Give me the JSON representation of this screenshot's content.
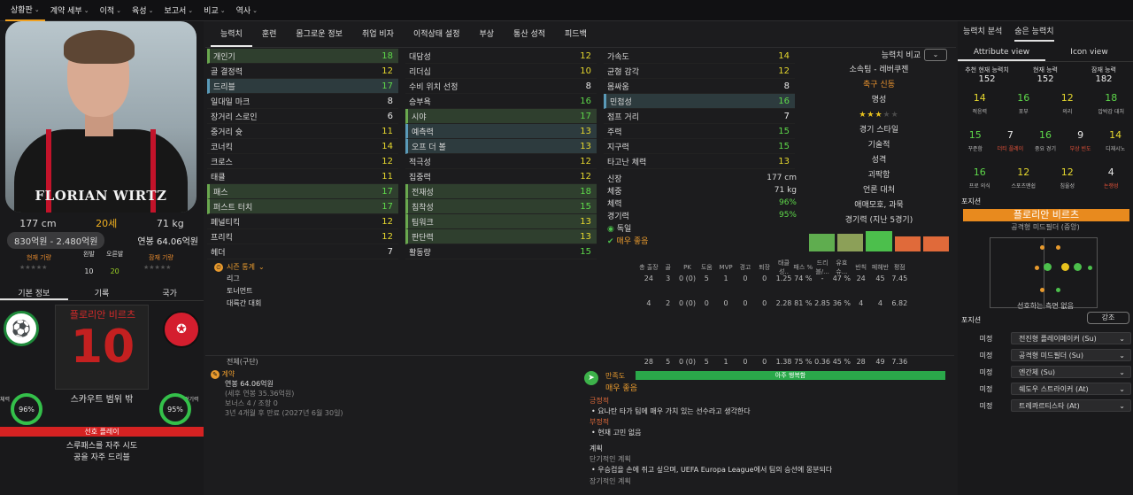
{
  "topbar": {
    "items": [
      {
        "label": "상황판",
        "active": true
      },
      {
        "label": "계약 세부"
      },
      {
        "label": "이적"
      },
      {
        "label": "육성"
      },
      {
        "label": "보고서"
      },
      {
        "label": "비교"
      },
      {
        "label": "역사"
      }
    ]
  },
  "player": {
    "photo_caption": "FLORIAN WIRTZ",
    "height": "177 cm",
    "age": "20세",
    "weight": "71 kg",
    "value_range": "830억원 - 2.480억원",
    "wage": "연봉 64.06억원",
    "current_ability_label": "현재 기량",
    "potential_ability_label": "잠재 기량",
    "left_foot_label": "왼발",
    "right_foot_label": "오른발",
    "left_foot_value": "10",
    "right_foot_value": "20",
    "name": "플로리안 비르츠",
    "number": "10",
    "scout_range": "스카우트 범위 밖",
    "condition_label": "체력",
    "condition": "96%",
    "sharpness_label": "경기력",
    "sharpness": "95%",
    "pref_label": "선호 플레이",
    "traits": [
      "스루패스를 자주 시도",
      "공을 자주 드리블"
    ]
  },
  "left_tabs": [
    "기본 정보",
    "기록",
    "국가"
  ],
  "tabs": [
    "능력치",
    "훈련",
    "몸그로운 정보",
    "취업 비자",
    "이적상태 설정",
    "부상",
    "통산 성적",
    "피드백"
  ],
  "technical": [
    {
      "name": "개인기",
      "value": "18",
      "hl": "hl2"
    },
    {
      "name": "골 결정력",
      "value": "12"
    },
    {
      "name": "드리블",
      "value": "17",
      "hl": "hl"
    },
    {
      "name": "일대일 마크",
      "value": "8"
    },
    {
      "name": "장거리 스로인",
      "value": "6"
    },
    {
      "name": "중거리 슛",
      "value": "11"
    },
    {
      "name": "코너킥",
      "value": "14"
    },
    {
      "name": "크로스",
      "value": "12"
    },
    {
      "name": "태클",
      "value": "11"
    },
    {
      "name": "패스",
      "value": "17",
      "hl": "hl2"
    },
    {
      "name": "퍼스트 터치",
      "value": "17",
      "hl": "hl2"
    },
    {
      "name": "페널티킥",
      "value": "12"
    },
    {
      "name": "프리킥",
      "value": "12"
    },
    {
      "name": "헤더",
      "value": "7"
    }
  ],
  "mental": [
    {
      "name": "대담성",
      "value": "12"
    },
    {
      "name": "리더십",
      "value": "10"
    },
    {
      "name": "수비 위치 선정",
      "value": "8"
    },
    {
      "name": "승부욕",
      "value": "16"
    },
    {
      "name": "시야",
      "value": "17",
      "hl": "hl2"
    },
    {
      "name": "예측력",
      "value": "13",
      "hl": "hl"
    },
    {
      "name": "오프 더 볼",
      "value": "13",
      "hl": "hl"
    },
    {
      "name": "적극성",
      "value": "12"
    },
    {
      "name": "집중력",
      "value": "12"
    },
    {
      "name": "전재성",
      "value": "18",
      "hl": "hl2"
    },
    {
      "name": "침착성",
      "value": "15",
      "hl": "hl2"
    },
    {
      "name": "팀워크",
      "value": "13",
      "hl": "hl2"
    },
    {
      "name": "판단력",
      "value": "13",
      "hl": "hl2"
    },
    {
      "name": "활동량",
      "value": "15"
    }
  ],
  "physical": [
    {
      "name": "가속도",
      "value": "14"
    },
    {
      "name": "균형 감각",
      "value": "12"
    },
    {
      "name": "몸싸움",
      "value": "8"
    },
    {
      "name": "민첩성",
      "value": "16",
      "hl": "hl"
    },
    {
      "name": "점프 거리",
      "value": "7"
    },
    {
      "name": "주력",
      "value": "15"
    },
    {
      "name": "지구력",
      "value": "15"
    },
    {
      "name": "타고난 체력",
      "value": "13"
    }
  ],
  "physical_info": [
    {
      "label": "신장",
      "value": "177 cm"
    },
    {
      "label": "체중",
      "value": "71 kg"
    },
    {
      "label": "체력",
      "value": "96%",
      "green": true
    },
    {
      "label": "경기력",
      "value": "95%",
      "green": true
    },
    {
      "label": "독일",
      "value": ""
    },
    {
      "label": "매우 좋음",
      "value": ""
    }
  ],
  "compare_label": "능력치 비교",
  "info": {
    "club": "소속팀 - 레버쿠젠",
    "club_status": "축구 신동",
    "reputation_label": "명성",
    "reputation_stars": 3,
    "style_label": "경기 스타일",
    "style": "기술적",
    "personality_label": "성격",
    "personality": "괴팍함",
    "media_label": "언론 대처",
    "media": "애매모호, 과묵",
    "form_label": "경기력 (지난 5경기)"
  },
  "form_bars": [
    {
      "value": 0.83,
      "color": "#5fad4f"
    },
    {
      "value": 0.83,
      "color": "#8ca058"
    },
    {
      "value": 0.95,
      "color": "#4cbf4c"
    },
    {
      "value": 0.7,
      "color": "#e06a3a"
    },
    {
      "value": 0.7,
      "color": "#e06a3a"
    }
  ],
  "stats": {
    "title": "시즌 통계",
    "columns": [
      "총 출장",
      "골",
      "PK",
      "도움",
      "MVP",
      "경고",
      "퇴장",
      "태클 성..",
      "패스 %",
      "드리블/...",
      "유효 슈...",
      "반칙",
      "페헤반",
      "평점"
    ],
    "rows": [
      {
        "label": "리그",
        "cells": [
          "24",
          "3",
          "0 (0)",
          "5",
          "1",
          "0",
          "0",
          "1.25",
          "74 %",
          "-",
          "47 %",
          "24",
          "45",
          "7.45"
        ]
      },
      {
        "label": "토너먼트",
        "cells": [
          "",
          "",
          "",
          "",
          "",
          "",
          "",
          "",
          "",
          "",
          "",
          "",
          "",
          ""
        ]
      },
      {
        "label": "대륙간 대회",
        "cells": [
          "4",
          "2",
          "0 (0)",
          "0",
          "0",
          "0",
          "0",
          "2.28",
          "81 %",
          "2.85",
          "36 %",
          "4",
          "4",
          "6.82"
        ]
      }
    ],
    "total_label": "전체(구단)",
    "total": [
      "28",
      "5",
      "0 (0)",
      "5",
      "1",
      "0",
      "0",
      "1.38",
      "75 %",
      "0.36",
      "45 %",
      "28",
      "49",
      "7.36"
    ]
  },
  "contract": {
    "title": "계약",
    "wage": "연봉 64.06억원",
    "tax": "(세후 연봉 35.36억원)",
    "bonus": "보너스 4 / 조항 0",
    "expiry": "3년 4개월 후 만료 (2027년 6월 30일)"
  },
  "satisfaction": {
    "title": "만족도",
    "bar_label": "아주 행복함",
    "level": "매우 좋음",
    "positive_label": "긍정적",
    "positive": "요나탄 타가 팀에 매우 가치 있는 선수라고 생각한다",
    "negative_label": "부정적",
    "negative": "현재 고민 없음",
    "plan_label": "계획",
    "short_label": "단기적인 계획",
    "short": "우승컵을 손에 쥐고 싶으며, UEFA Europa League에서 팀의 승선에 몽분되다",
    "long_label": "장기적인 계획"
  },
  "right": {
    "tab1": "능력치 분석",
    "tab2": "숨은 능력치",
    "view1": "Attribute view",
    "view2": "Icon view",
    "ratings": [
      {
        "label": "추천 현재 능력치",
        "value": "152"
      },
      {
        "label": "현재 능력",
        "value": "152"
      },
      {
        "label": "잠재 능력",
        "value": "182"
      }
    ],
    "hidden1": [
      {
        "value": "14",
        "label": "적응력",
        "color": "#e6d82e"
      },
      {
        "value": "16",
        "label": "포부",
        "color": "#5ed84a"
      },
      {
        "value": "12",
        "label": "의리",
        "color": "#e6d82e"
      },
      {
        "value": "18",
        "label": "압박감 대처",
        "color": "#5ed84a"
      }
    ],
    "hidden2": [
      {
        "value": "15",
        "label": "꾸준함",
        "color": "#5ed84a"
      },
      {
        "value": "7",
        "label": "더티 플레이",
        "color": "#e8e8e8"
      },
      {
        "value": "16",
        "label": "중요 경기",
        "color": "#5ed84a"
      },
      {
        "value": "9",
        "label": "부상 빈도",
        "color": "#e8e8e8"
      },
      {
        "value": "14",
        "label": "디재시노",
        "color": "#e6d82e"
      }
    ],
    "hidden3": [
      {
        "value": "16",
        "label": "프로 의식",
        "color": "#5ed84a"
      },
      {
        "value": "12",
        "label": "스포츠맨쉽",
        "color": "#e6d82e"
      },
      {
        "value": "12",
        "label": "침울성",
        "color": "#e6d82e"
      },
      {
        "value": "4",
        "label": "논쟁성",
        "color": "#e8e8e8"
      }
    ],
    "position_label": "포지션",
    "position_main": "플로리안 비르츠",
    "position_sub": "공격형 미드필더 (중앙)",
    "position_note": "선호하는 측면 없음",
    "role_label": "포지션",
    "role_button": "강조",
    "roles": [
      {
        "level": "미정",
        "name": "전진형 플레이메이커 (Su)"
      },
      {
        "level": "미정",
        "name": "공격형 미드필더 (Su)"
      },
      {
        "level": "미정",
        "name": "엔간체 (Su)"
      },
      {
        "level": "미정",
        "name": "쉐도우 스트라이커 (At)"
      },
      {
        "level": "미정",
        "name": "트레콰르티스타 (At)"
      }
    ]
  }
}
